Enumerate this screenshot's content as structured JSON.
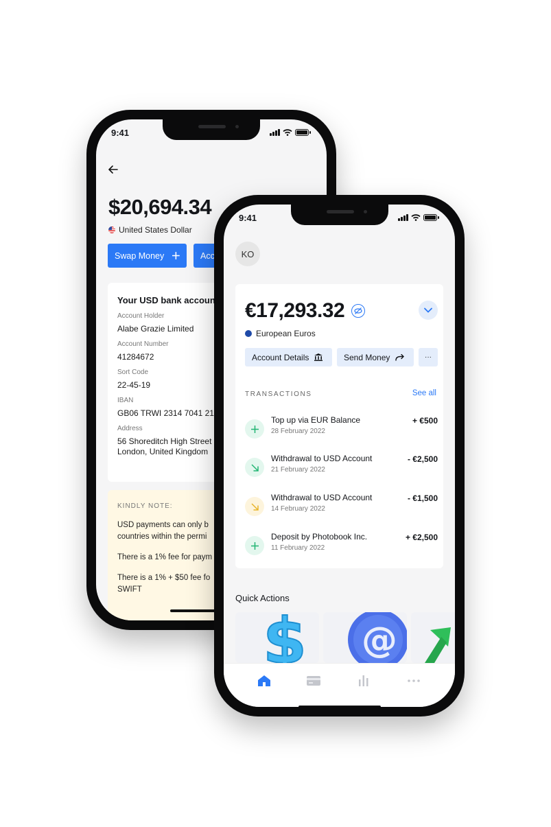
{
  "back_phone": {
    "status_time": "9:41",
    "balance": "$20,694.34",
    "currency": "United States Dollar",
    "buttons": {
      "swap": "Swap Money",
      "account": "Acc"
    },
    "bank_card": {
      "title": "Your USD bank accoun",
      "fields": [
        {
          "label": "Account Holder",
          "value": "Alabe Grazie Limited"
        },
        {
          "label": "Account Number",
          "value": "41284672"
        },
        {
          "label": "Sort Code",
          "value": "22-45-19"
        },
        {
          "label": "IBAN",
          "value": "GB06 TRWI 2314 7041 217"
        },
        {
          "label": "Address",
          "value": "56 Shoreditch High Street",
          "value2": "London, United Kingdom"
        }
      ]
    },
    "note": {
      "header": "KINDLY NOTE:",
      "p1_line1": "USD payments can only b",
      "p1_line2": "countries within the permi",
      "p2": "There is a 1% fee for paym",
      "p3_line1": "There is a 1% + $50 fee fo",
      "p3_line2": "SWIFT"
    }
  },
  "front_phone": {
    "status_time": "9:41",
    "avatar_initials": "KO",
    "balance": "€17,293.32",
    "currency": "European Euros",
    "buttons": {
      "account_details": "Account Details",
      "send_money": "Send Money",
      "more": "···"
    },
    "transactions_header": "TRANSACTIONS",
    "see_all": "See all",
    "transactions": [
      {
        "title": "Top up via EUR Balance",
        "date": "28 February 2022",
        "amount": "+ €500",
        "icon": "plus-icon",
        "icon_color": "#22b573",
        "icon_bg": "#e3f7ee"
      },
      {
        "title": "Withdrawal to USD Account",
        "date": "21 February 2022",
        "amount": "- €2,500",
        "icon": "arrow-down-right-icon",
        "icon_color": "#22b573",
        "icon_bg": "#e3f7ee"
      },
      {
        "title": "Withdrawal to USD Account",
        "date": "14 February 2022",
        "amount": "- €1,500",
        "icon": "arrow-down-right-icon",
        "icon_color": "#e8b52a",
        "icon_bg": "#fdf4dc"
      },
      {
        "title": "Deposit by Photobook Inc.",
        "date": "11 February 2022",
        "amount": "+ €2,500",
        "icon": "plus-icon",
        "icon_color": "#22b573",
        "icon_bg": "#e3f7ee"
      }
    ],
    "quick_actions_title": "Quick Actions",
    "quick_actions": [
      {
        "icon": "dollar-3d-icon",
        "color": "#3fb6f2"
      },
      {
        "icon": "at-sign-3d-icon",
        "color": "#4b6fe8"
      },
      {
        "icon": "green-arrow-3d-icon",
        "color": "#2fbf5a"
      }
    ],
    "tabs": [
      {
        "icon": "home-icon",
        "active": true
      },
      {
        "icon": "card-icon",
        "active": false
      },
      {
        "icon": "chart-icon",
        "active": false
      },
      {
        "icon": "more-icon",
        "active": false
      }
    ],
    "accent": "#2b79f6"
  }
}
